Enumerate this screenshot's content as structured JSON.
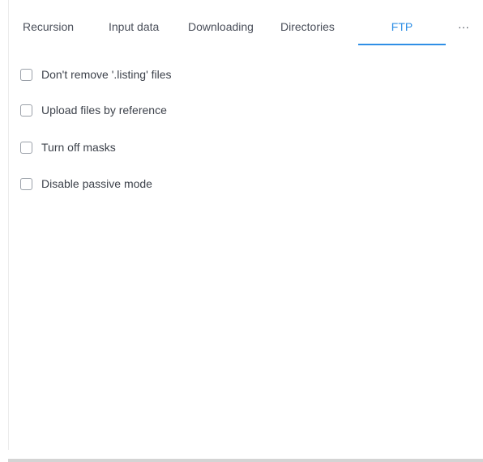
{
  "tabs": [
    {
      "label": "Recursion",
      "active": false
    },
    {
      "label": "Input data",
      "active": false
    },
    {
      "label": "Downloading",
      "active": false
    },
    {
      "label": "Directories",
      "active": false
    },
    {
      "label": "FTP",
      "active": true
    },
    {
      "label": "···",
      "active": false
    }
  ],
  "options": [
    {
      "label": "Don't remove '.listing' files",
      "checked": false
    },
    {
      "label": "Upload files by reference",
      "checked": false
    },
    {
      "label": "Turn off masks",
      "checked": false
    },
    {
      "label": "Disable passive mode",
      "checked": false
    }
  ],
  "colors": {
    "accent": "#2f8fe6",
    "text": "#3d424b",
    "checkbox_border": "#9aa0a8"
  }
}
